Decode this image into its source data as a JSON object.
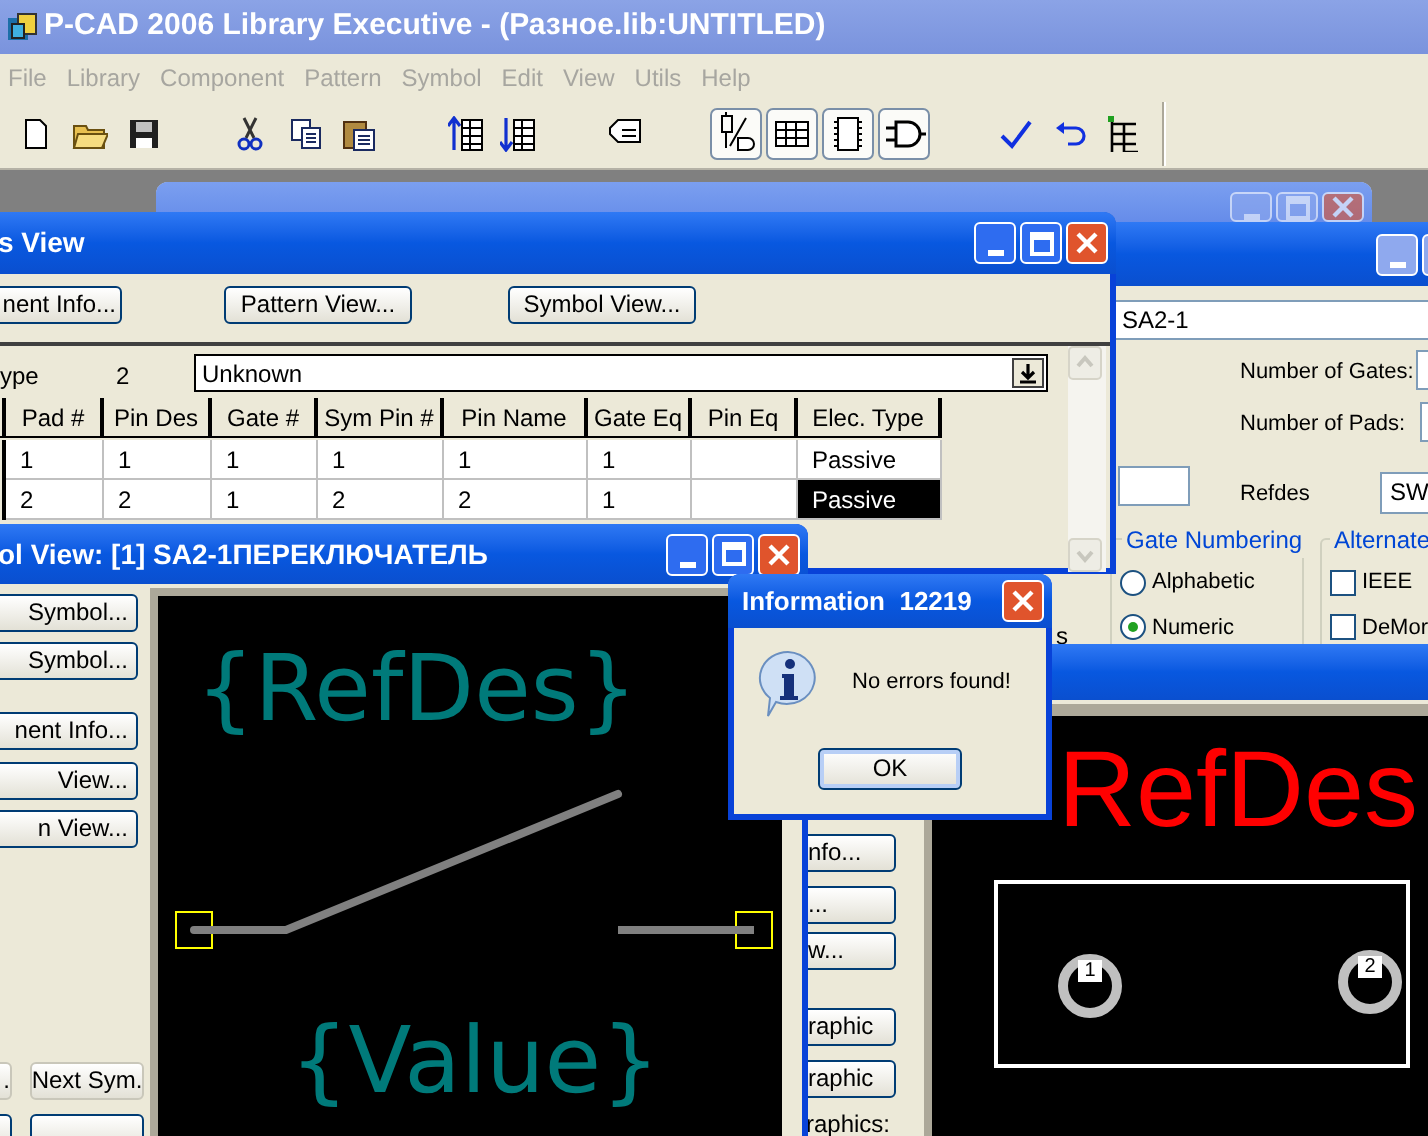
{
  "app_window": {
    "title": "P-CAD 2006 Library Executive - (Разное.lib:UNTITLED)",
    "menu": [
      "File",
      "Library",
      "Component",
      "Pattern",
      "Symbol",
      "Edit",
      "View",
      "Utils",
      "Help"
    ]
  },
  "pins_window": {
    "title": "s View",
    "buttons": [
      "nent Info...",
      "Pattern View...",
      "Symbol View..."
    ],
    "type_label": "ype",
    "type_count": "2",
    "type_dropdown": "Unknown",
    "columns": [
      "Pad #",
      "Pin Des",
      "Gate #",
      "Sym Pin #",
      "Pin Name",
      "Gate Eq",
      "Pin Eq",
      "Elec. Type"
    ],
    "rows": [
      {
        "cells": [
          "1",
          "1",
          "1",
          "1",
          "1",
          "1",
          "",
          "Passive"
        ],
        "selected": false
      },
      {
        "cells": [
          "2",
          "2",
          "1",
          "2",
          "2",
          "1",
          "",
          "Passive"
        ],
        "selected": true
      }
    ]
  },
  "component_window": {
    "name_field": "SA2-1",
    "labels": [
      "Number of Gates:",
      "Number of Pads:",
      "Refdes"
    ],
    "refdes_field": "SW",
    "cut_label": "s",
    "gate_numbering": {
      "title": "Gate Numbering",
      "options": [
        {
          "label": "Alphabetic",
          "selected": false
        },
        {
          "label": "Numeric",
          "selected": true
        }
      ]
    },
    "alternate": {
      "title": "Alternate",
      "options": [
        {
          "label": "IEEE",
          "checked": false
        },
        {
          "label": "DeMor",
          "checked": false
        }
      ]
    }
  },
  "symbol_window": {
    "title": "ol View: [1] SA2-1ПЕРЕКЛЮЧАТЕЛЬ",
    "buttons": [
      "Symbol...",
      "Symbol...",
      "nent Info...",
      "View...",
      "n View..."
    ],
    "nav_buttons": [
      {
        "label": ".",
        "disabled": true
      },
      {
        "label": "Next Sym.",
        "disabled": true
      }
    ],
    "refdes": "{RefDes}",
    "value": "{Value}"
  },
  "pattern_window": {
    "buttons": [
      "nfo...",
      "...",
      "w...",
      "raphic",
      "raphic"
    ],
    "label": "raphics:",
    "refdes": "RefDes",
    "pads": [
      "1",
      "2"
    ]
  },
  "dialog": {
    "title": "Information  12219",
    "message": "No errors found!",
    "button": "OK"
  }
}
